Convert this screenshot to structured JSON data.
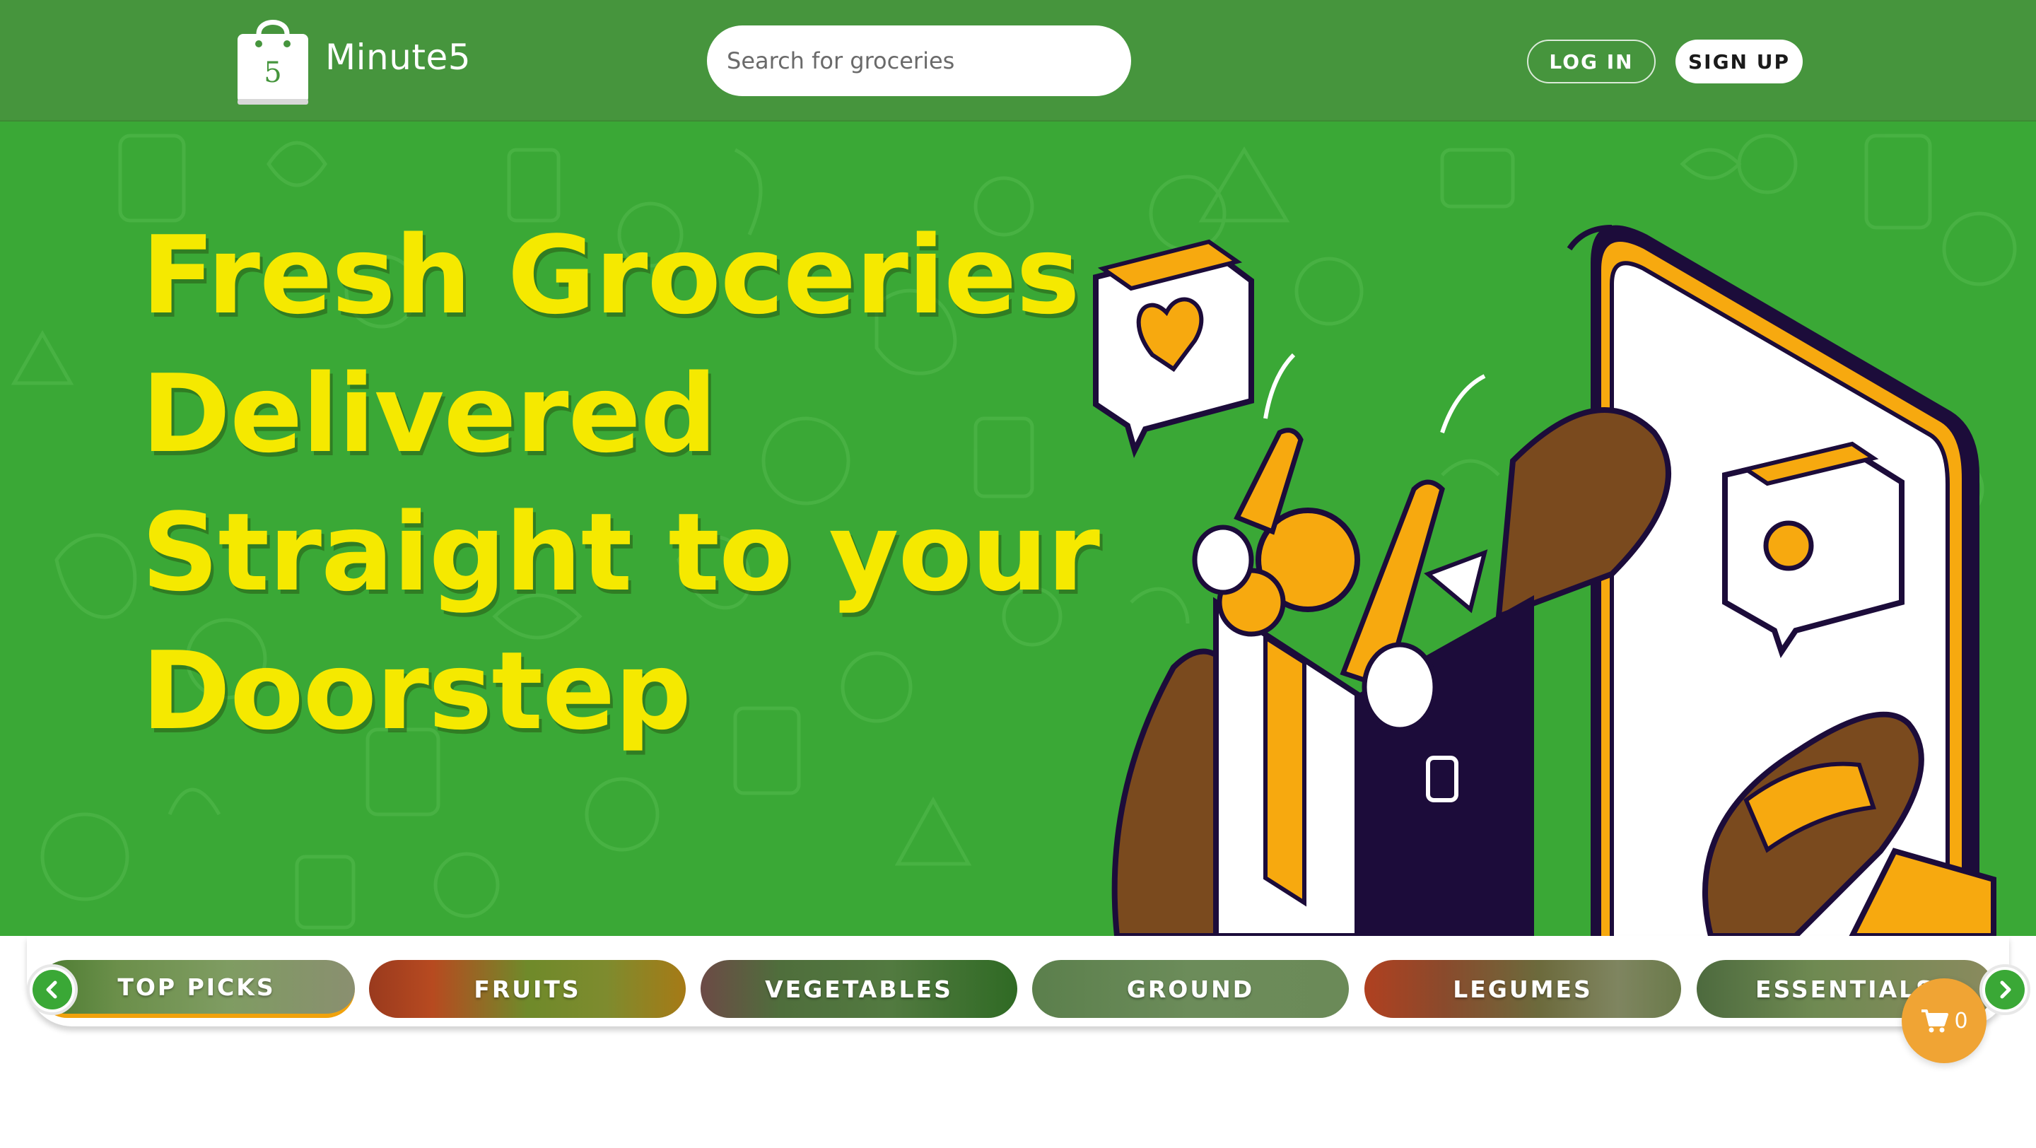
{
  "header": {
    "brand": "Minute5",
    "logo_digit": "5",
    "search_placeholder": "Search for groceries",
    "login_label": "LOG IN",
    "signup_label": "SIGN UP"
  },
  "hero": {
    "headline_lines": [
      "Fresh Groceries",
      "Delivered",
      "Straight to your",
      "Doorstep"
    ]
  },
  "categories": [
    {
      "label": "TOP PICKS",
      "active": true
    },
    {
      "label": "FRUITS",
      "active": false
    },
    {
      "label": "VEGETABLES",
      "active": false
    },
    {
      "label": "GROUND",
      "active": false
    },
    {
      "label": "LEGUMES",
      "active": false
    },
    {
      "label": "ESSENTIALS",
      "active": false
    }
  ],
  "cart": {
    "count": "0"
  },
  "icons": {
    "logo": "shopping-bag-icon",
    "prev": "chevron-left-icon",
    "next": "chevron-right-icon",
    "cart": "cart-icon"
  },
  "colors": {
    "header_bg": "#46953d",
    "hero_bg": "#3aa836",
    "headline": "#f5e900",
    "accent": "#f0a20c",
    "cart_bg": "#f0a434"
  }
}
